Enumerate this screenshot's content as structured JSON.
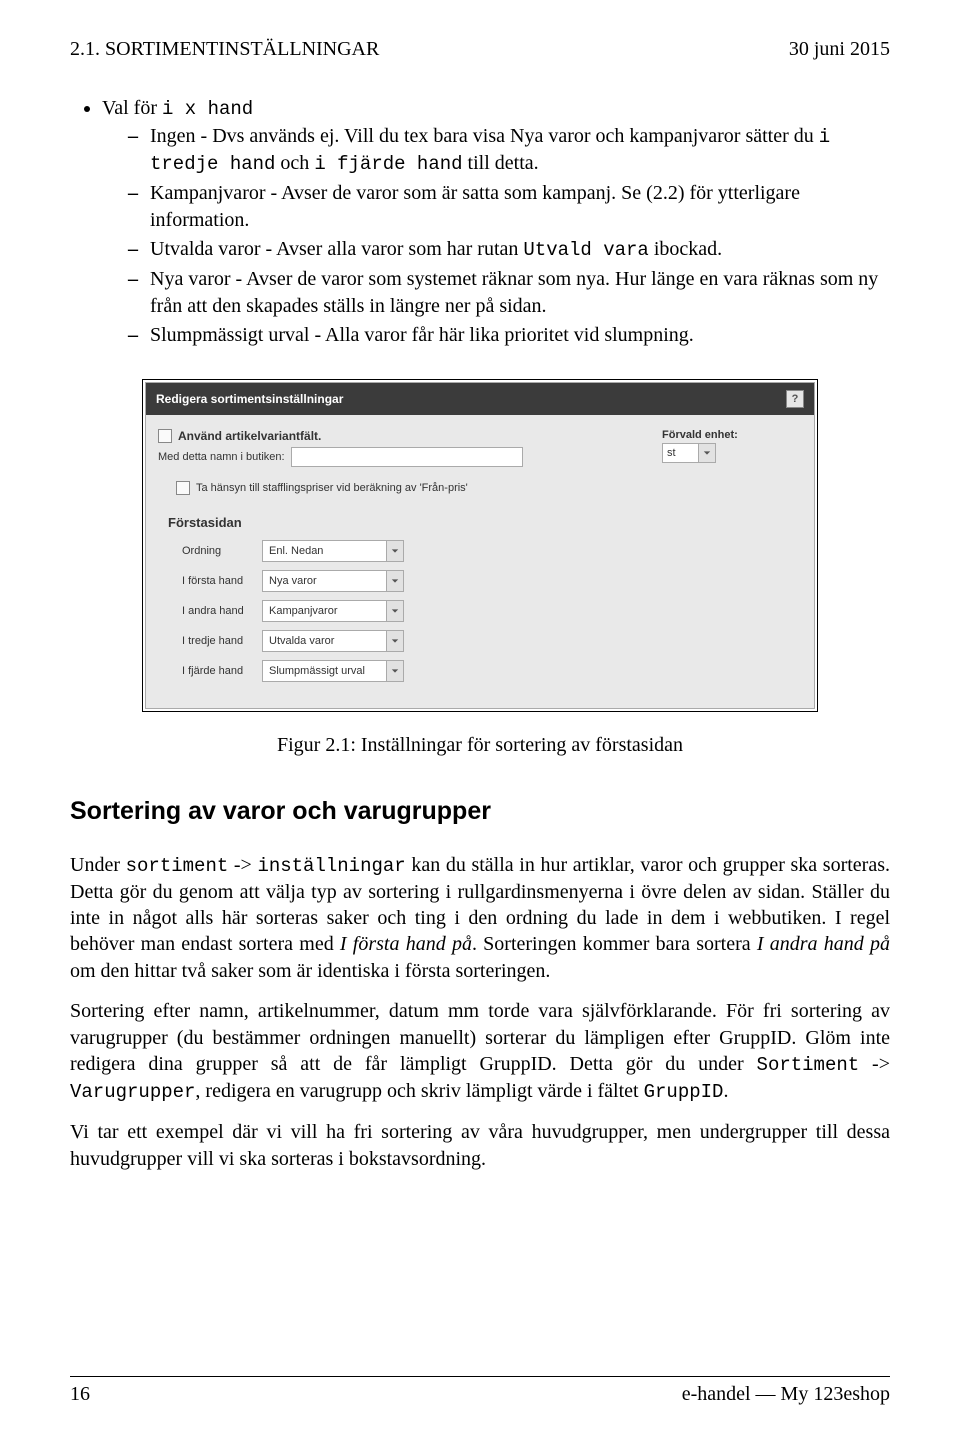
{
  "header": {
    "left": "2.1. SORTIMENTINSTÄLLNINGAR",
    "right": "30 juni 2015"
  },
  "list": {
    "lead_plain": "Val för ",
    "lead_tt": "i x hand",
    "items": {
      "a": {
        "pre": "Ingen - Dvs används ej. Vill du tex bara visa Nya varor och kampanjvaror sätter du ",
        "tt1": "i tredje hand",
        "mid": " och ",
        "tt2": "i fjärde hand",
        "post": " till detta."
      },
      "b": "Kampanjvaror - Avser de varor som är satta som kampanj. Se (2.2) för ytterligare information.",
      "c": {
        "pre": "Utvalda varor - Avser alla varor som har rutan ",
        "tt": "Utvald vara",
        "post": " ibockad."
      },
      "d": "Nya varor - Avser de varor som systemet räknar som nya. Hur länge en vara räknas som ny från att den skapades ställs in längre ner på sidan.",
      "e": "Slumpmässigt urval - Alla varor får här lika prioritet vid slumpning."
    }
  },
  "panel": {
    "title": "Redigera sortimentsinställningar",
    "chk1": "Använd artikelvariantfält.",
    "sublabel": "Med detta namn i butiken:",
    "rightLabel": "Förvald enhet:",
    "rightValue": "st",
    "chk2": "Ta hänsyn till stafflingspriser vid beräkning av 'Från-pris'",
    "sectionTitle": "Förstasidan",
    "rows": {
      "r0": {
        "lbl": "Ordning",
        "val": "Enl. Nedan"
      },
      "r1": {
        "lbl": "I första hand",
        "val": "Nya varor"
      },
      "r2": {
        "lbl": "I andra hand",
        "val": "Kampanjvaror"
      },
      "r3": {
        "lbl": "I tredje hand",
        "val": "Utvalda varor"
      },
      "r4": {
        "lbl": "I fjärde hand",
        "val": "Slumpmässigt urval"
      }
    }
  },
  "caption": "Figur 2.1: Inställningar för sortering av förstasidan",
  "section_title": "Sortering av varor och varugrupper",
  "para1": {
    "p1": "Under ",
    "tt1": "sortiment",
    "p2": " -> ",
    "tt2": "inställningar",
    "p3": " kan du ställa in hur artiklar, varor och grupper ska sorteras. Detta gör du genom att välja typ av sortering i rullgardinsmenyerna i övre delen av sidan. Ställer du inte in något alls här sorteras saker och ting i den ordning du lade in dem i webbutiken. I regel behöver man endast sortera med ",
    "it1": "I första hand på",
    "p4": ". Sorteringen kommer bara sortera ",
    "it2": "I andra hand på",
    "p5": " om den hittar två saker som är identiska i första sorteringen."
  },
  "para2": {
    "a": "Sortering efter namn, artikelnummer, datum mm torde vara självförklarande. För fri sortering av varugrupper (du bestämmer ordningen manuellt) sorterar du lämpligen efter GruppID. Glöm inte redigera dina grupper så att de får lämpligt GruppID. Detta gör du under ",
    "tt1": "Sortiment",
    "mid": " -> ",
    "tt2": "Varugrupper",
    "b": ", redigera en varugrupp och skriv lämpligt värde i fältet ",
    "tt3": "GruppID",
    "c": "."
  },
  "para3": "Vi tar ett exempel där vi vill ha fri sortering av våra huvudgrupper, men undergrupper till dessa huvudgrupper vill vi ska sorteras i bokstavsordning.",
  "footer": {
    "left": "16",
    "right": "e-handel — My 123eshop"
  }
}
